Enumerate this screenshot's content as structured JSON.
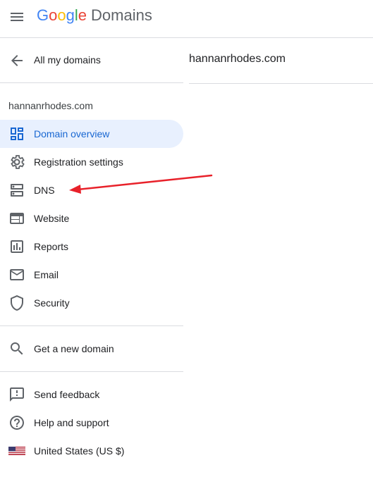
{
  "header": {
    "logo_letters": [
      "G",
      "o",
      "o",
      "g",
      "l",
      "e"
    ],
    "product": "Domains"
  },
  "nav": {
    "back_label": "All my domains",
    "domain": "hannanrhodes.com",
    "items": [
      {
        "label": "Domain overview",
        "icon": "dashboard-icon",
        "active": true
      },
      {
        "label": "Registration settings",
        "icon": "gear-icon"
      },
      {
        "label": "DNS",
        "icon": "dns-icon"
      },
      {
        "label": "Website",
        "icon": "web-icon"
      },
      {
        "label": "Reports",
        "icon": "insert-chart-icon"
      },
      {
        "label": "Email",
        "icon": "mail-icon"
      },
      {
        "label": "Security",
        "icon": "shield-icon"
      }
    ],
    "get_domain": {
      "label": "Get a new domain",
      "icon": "search-icon"
    },
    "footer": [
      {
        "label": "Send feedback",
        "icon": "feedback-icon"
      },
      {
        "label": "Help and support",
        "icon": "help-icon"
      },
      {
        "label": "United States (US $)",
        "icon": "us-flag-icon"
      }
    ]
  },
  "main": {
    "domain_title": "hannanrhodes.com"
  },
  "colors": {
    "active_bg": "#e8f0fe",
    "active_text": "#1967d2",
    "annotation_arrow": "#e8212a"
  }
}
